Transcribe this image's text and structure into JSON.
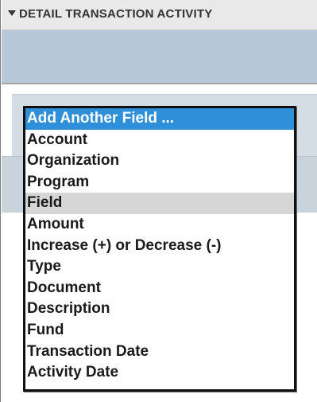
{
  "section": {
    "title": "DETAIL TRANSACTION ACTIVITY"
  },
  "dropdown": {
    "options": [
      "Add Another Field ...",
      "Account",
      "Organization",
      "Program",
      "Field",
      "Amount",
      "Increase (+) or Decrease (-)",
      "Type",
      "Document",
      "Description",
      "Fund",
      "Transaction Date",
      "Activity Date"
    ],
    "selected_index": 0,
    "hover_index": 4
  },
  "colors": {
    "selected_bg": "#2f8fd9",
    "hover_bg": "#d6d6d6",
    "header_bg": "#e9e9e9",
    "band_bg": "#b7c9d8"
  }
}
